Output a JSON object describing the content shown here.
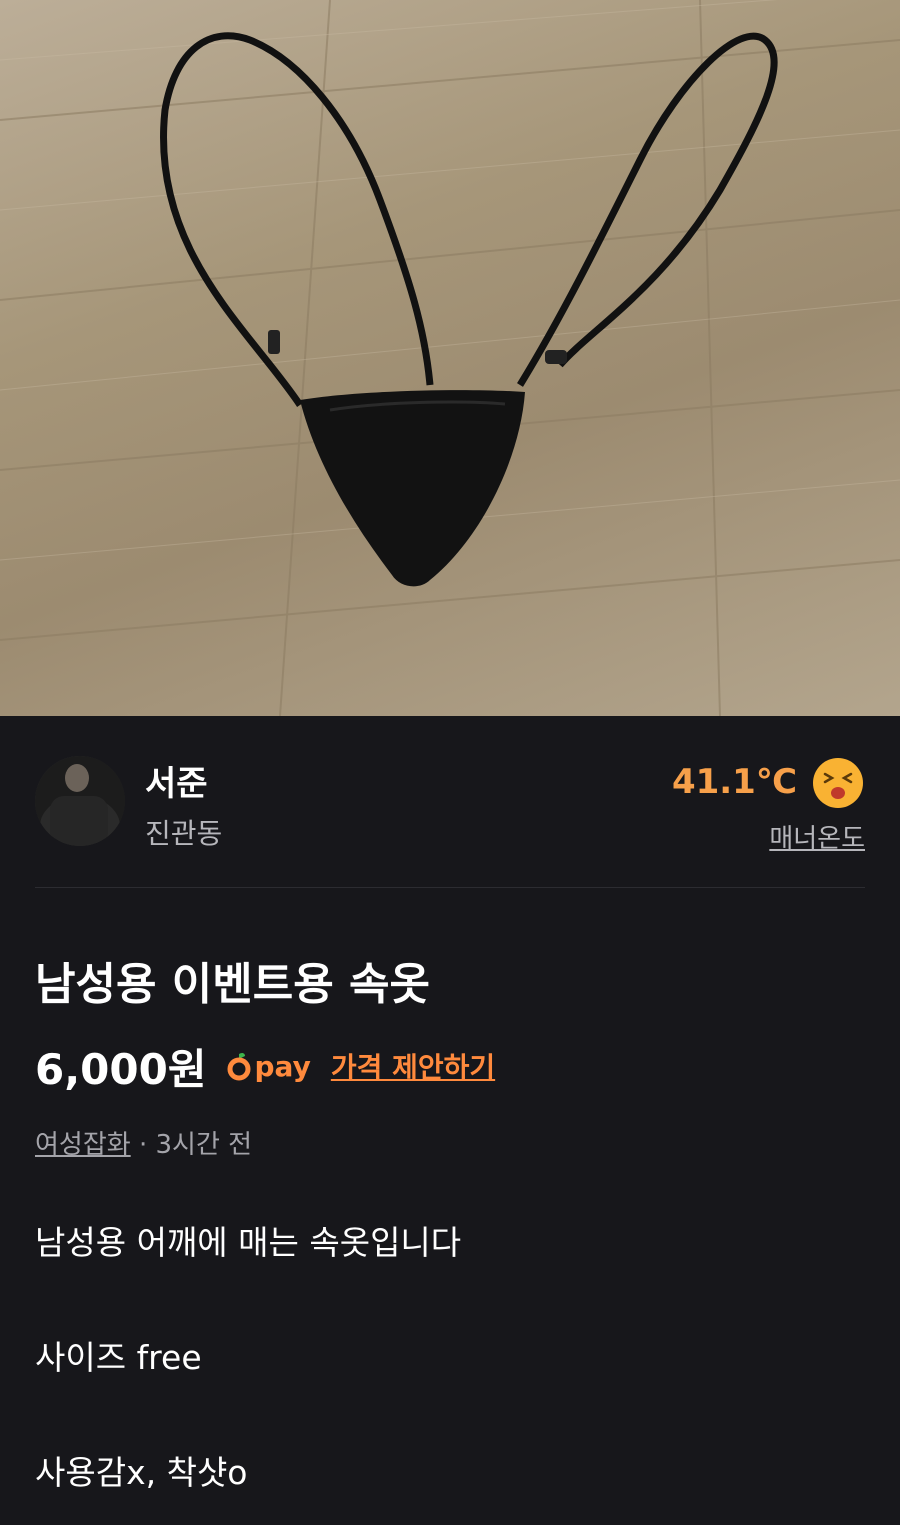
{
  "product": {
    "image_alt": "black underwear with long straps on a wooden floor"
  },
  "seller": {
    "name": "서준",
    "location": "진관동",
    "manner_temperature": "41.1℃",
    "manner_label": "매너온도"
  },
  "listing": {
    "title": "남성용 이벤트용 속옷",
    "price": "6,000원",
    "pay_label": "pay",
    "offer_label": "가격 제안하기",
    "category": "여성잡화",
    "separator": " · ",
    "posted": "3시간 전",
    "description": [
      "남성용 어깨에 매는 속옷입니다",
      "사이즈 free",
      "사용감x, 착샷o"
    ]
  },
  "colors": {
    "background": "#17171b",
    "accent": "#ff8a3d",
    "temperature": "#f7a04a"
  },
  "icons": {
    "temperature_face": "laughing-face-icon",
    "pay_logo": "carrot-pay-icon"
  }
}
